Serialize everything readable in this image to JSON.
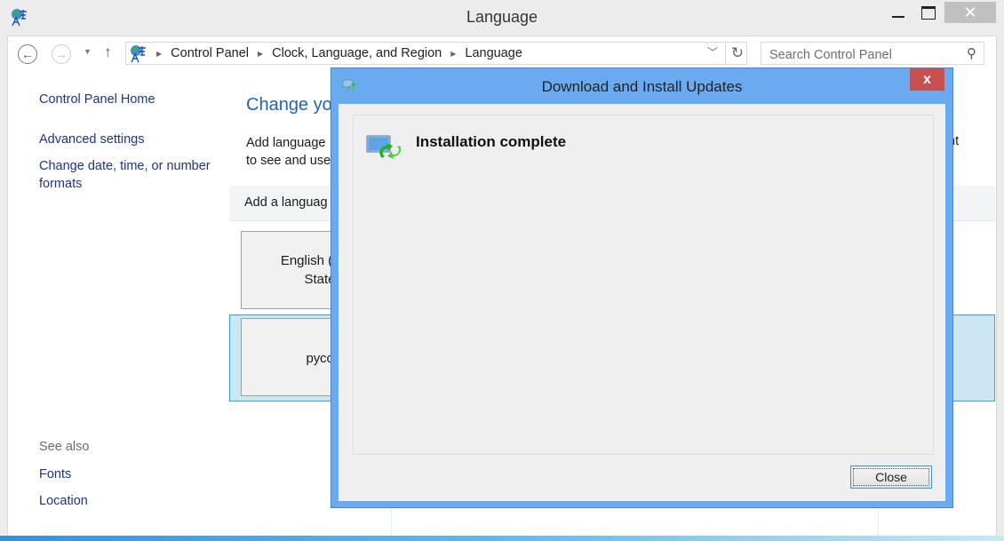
{
  "window": {
    "title": "Language",
    "controls": {
      "minimize": "minimize",
      "maximize": "maximize",
      "close": "✕"
    }
  },
  "navigation": {
    "back": "←",
    "forward": "→",
    "recent": "▼",
    "up": "↑",
    "breadcrumbs": [
      "Control Panel",
      "Clock, Language, and Region",
      "Language"
    ],
    "dropdown": "⌄",
    "refresh": "↻",
    "search_placeholder": "Search Control Panel",
    "search_icon": "⚲"
  },
  "sidebar": {
    "links": [
      "Control Panel Home",
      "Advanced settings",
      "Change date, time, or number",
      "formats"
    ],
    "see_also_label": "See also",
    "see_also_links": [
      "Fonts",
      "Location"
    ]
  },
  "main": {
    "title": "Change yo",
    "description_line1": "Add language",
    "description_line2": "to see and use",
    "description_tail": "nt",
    "toolbar_add": "Add a languag",
    "languages": [
      {
        "line1": "English (Ur",
        "line2": "States)"
      },
      {
        "line1": "русски",
        "line2": ""
      }
    ],
    "selected_index": 1
  },
  "dialog": {
    "title": "Download and Install Updates",
    "close_icon": "x",
    "status": "Installation complete",
    "close_button": "Close"
  },
  "colors": {
    "dialog_frame": "#6aaaf0",
    "dialog_close": "#c75050",
    "link": "#1e3287",
    "heading": "#1e64be",
    "selection": "#cce6f4"
  }
}
